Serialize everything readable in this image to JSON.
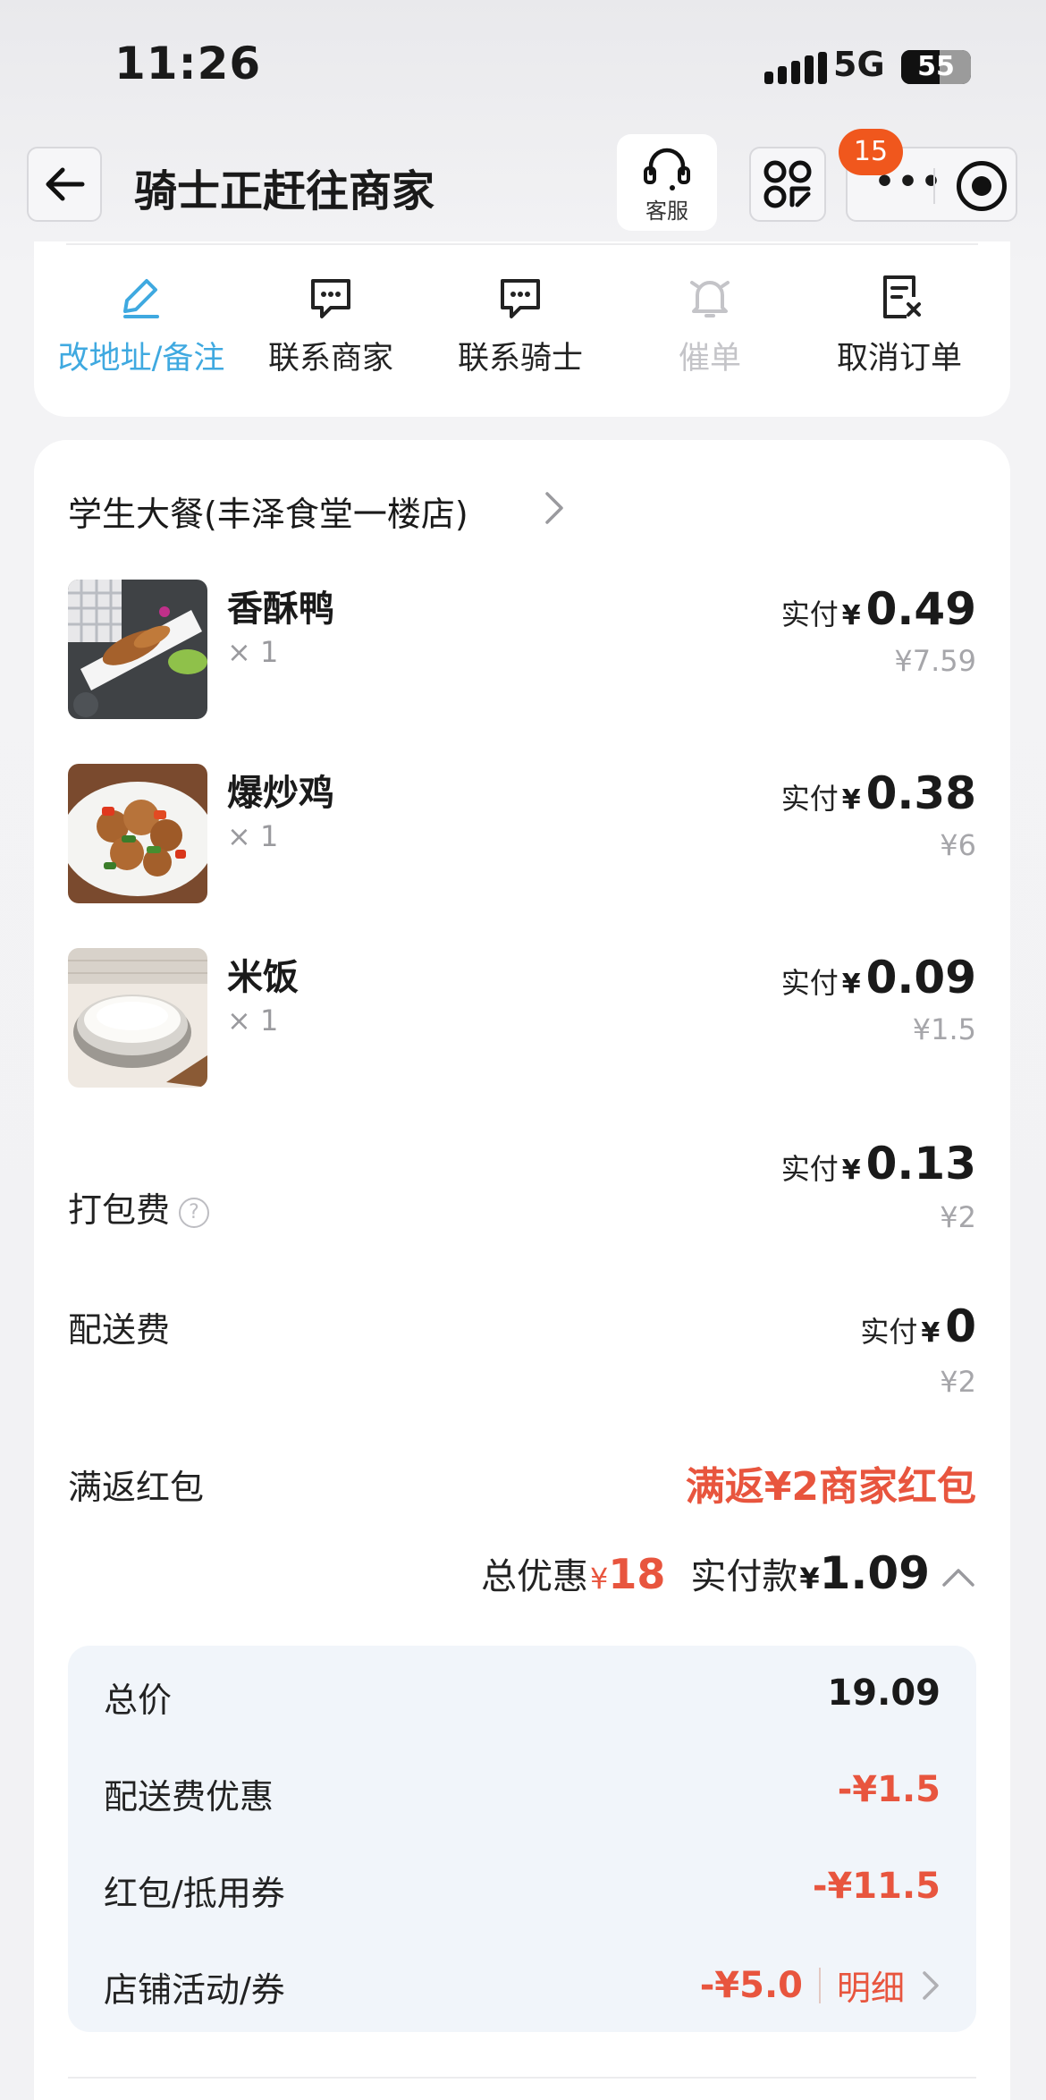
{
  "status_bar": {
    "time": "11:26",
    "network": "5G",
    "battery": "55",
    "battery_level": 0.55
  },
  "nav": {
    "title": "骑士正赶往商家",
    "service_label": "客服",
    "badge_count": "15"
  },
  "actions": [
    {
      "label": "改地址/备注",
      "icon": "edit-icon",
      "state": "active"
    },
    {
      "label": "联系商家",
      "icon": "chat-icon",
      "state": "normal"
    },
    {
      "label": "联系骑士",
      "icon": "chat-icon",
      "state": "normal"
    },
    {
      "label": "催单",
      "icon": "bell-icon",
      "state": "disabled"
    },
    {
      "label": "取消订单",
      "icon": "cancel-order-icon",
      "state": "normal"
    }
  ],
  "order": {
    "store_name": "学生大餐(丰泽食堂一楼店)",
    "items": [
      {
        "name": "香酥鸭",
        "qty": "× 1",
        "pay_label": "实付",
        "currency": "¥",
        "pay_amount": "0.49",
        "original_price": "¥7.59"
      },
      {
        "name": "爆炒鸡",
        "qty": "× 1",
        "pay_label": "实付",
        "currency": "¥",
        "pay_amount": "0.38",
        "original_price": "¥6"
      },
      {
        "name": "米饭",
        "qty": "× 1",
        "pay_label": "实付",
        "currency": "¥",
        "pay_amount": "0.09",
        "original_price": "¥1.5"
      }
    ],
    "fees": {
      "packing": {
        "label": "打包费",
        "help": "?",
        "pay_label": "实付",
        "currency": "¥",
        "pay_amount": "0.13",
        "original_price": "¥2"
      },
      "delivery": {
        "label": "配送费",
        "pay_label": "实付",
        "currency": "¥",
        "pay_amount": "0",
        "original_price": "¥2"
      }
    },
    "redpack": {
      "label": "满返红包",
      "value": "满返¥2商家红包"
    },
    "summary": {
      "discount_label": "总优惠",
      "discount_currency": "¥",
      "discount_amount": "18",
      "paid_label": "实付款",
      "paid_currency": "¥",
      "paid_amount": "1.09"
    },
    "detail": {
      "total": {
        "label": "总价",
        "value": "19.09"
      },
      "delivery_discount": {
        "label": "配送费优惠",
        "value": "-¥1.5"
      },
      "coupon": {
        "label": "红包/抵用券",
        "value": "-¥11.5"
      },
      "store_activity": {
        "label": "店铺活动/券",
        "value": "-¥5.0",
        "link": "明细"
      }
    }
  },
  "colors": {
    "accent_blue": "#3fa9e0",
    "price_red": "#e8553e",
    "badge_orange": "#f0571d"
  }
}
